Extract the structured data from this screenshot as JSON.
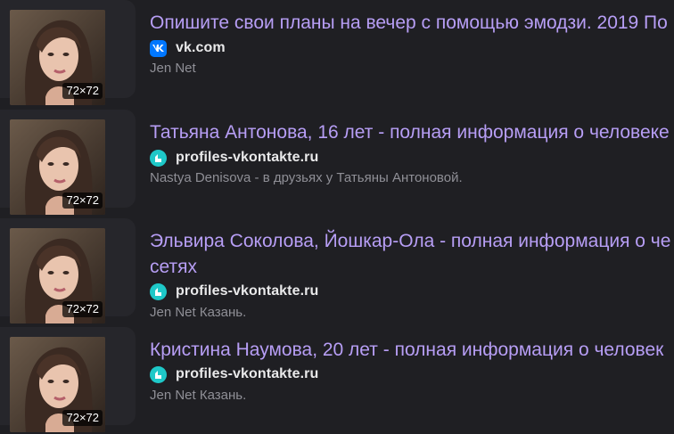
{
  "colors": {
    "background": "#1f1f23",
    "title_link": "#b79ef5",
    "domain_text": "#e9e9ea",
    "snippet_text": "#8f8f96",
    "vk_brand": "#0077ff",
    "profiles_brand": "#1ec8c8"
  },
  "results": [
    {
      "thumbnail_badge": "72×72",
      "title": "Опишите свои планы на вечер с помощью эмодзи. 2019 По",
      "favicon": "vk-icon",
      "domain": "vk.com",
      "snippet": "Jen Net"
    },
    {
      "thumbnail_badge": "72×72",
      "title": "Татьяна Антонова, 16 лет - полная информация о человеке",
      "favicon": "profiles-vkontakte-icon",
      "domain": "profiles-vkontakte.ru",
      "snippet": "Nastya Denisova - в друзьях у Татьяны Антоновой."
    },
    {
      "thumbnail_badge": "72×72",
      "title": "Эльвира Соколова, Йошкар-Ола - полная информация о че сетях",
      "favicon": "profiles-vkontakte-icon",
      "domain": "profiles-vkontakte.ru",
      "snippet": "Jen Net Казань."
    },
    {
      "thumbnail_badge": "72×72",
      "title": "Кристина Наумова, 20 лет - полная информация о человек",
      "favicon": "profiles-vkontakte-icon",
      "domain": "profiles-vkontakte.ru",
      "snippet": "Jen Net Казань."
    }
  ]
}
